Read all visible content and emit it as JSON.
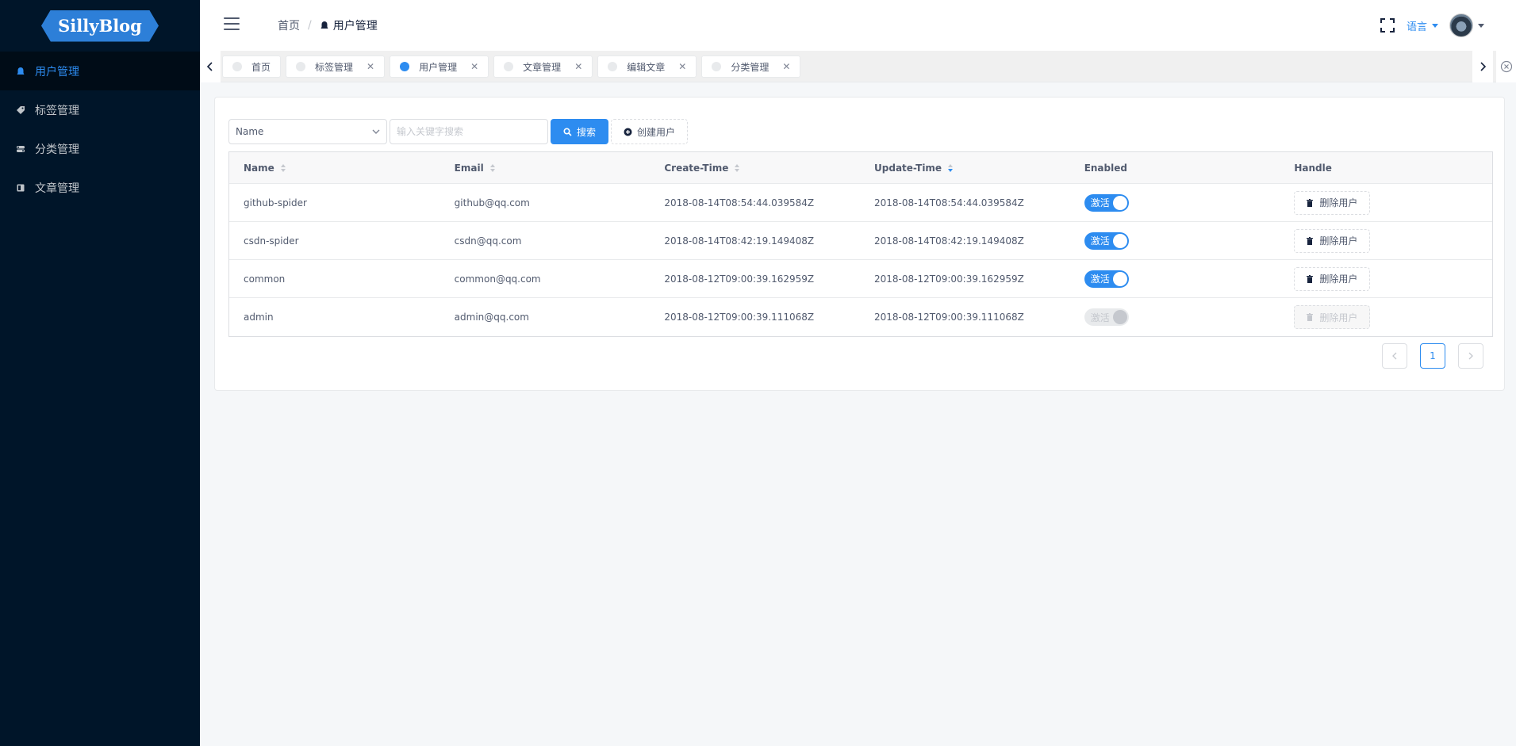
{
  "app": {
    "logo_text": "SillyBlog"
  },
  "sidebar": {
    "items": [
      {
        "label": "用户管理",
        "icon": "user-icon",
        "active": true
      },
      {
        "label": "标签管理",
        "icon": "tag-icon",
        "active": false
      },
      {
        "label": "分类管理",
        "icon": "category-icon",
        "active": false
      },
      {
        "label": "文章管理",
        "icon": "article-icon",
        "active": false
      }
    ]
  },
  "header": {
    "breadcrumb": {
      "home": "首页",
      "separator": "/",
      "current": "用户管理"
    },
    "language_label": "语言"
  },
  "tags": [
    {
      "label": "首页",
      "active": false,
      "closable": false
    },
    {
      "label": "标签管理",
      "active": false,
      "closable": true
    },
    {
      "label": "用户管理",
      "active": true,
      "closable": true
    },
    {
      "label": "文章管理",
      "active": false,
      "closable": true
    },
    {
      "label": "编辑文章",
      "active": false,
      "closable": true
    },
    {
      "label": "分类管理",
      "active": false,
      "closable": true
    }
  ],
  "filter": {
    "select_value": "Name",
    "search_placeholder": "输入关键字搜索",
    "search_button": "搜索",
    "create_button": "创建用户"
  },
  "table": {
    "columns": [
      "Name",
      "Email",
      "Create-Time",
      "Update-Time",
      "Enabled",
      "Handle"
    ],
    "rows": [
      {
        "name": "github-spider",
        "email": "github@qq.com",
        "create_time": "2018-08-14T08:54:44.039584Z",
        "update_time": "2018-08-14T08:54:44.039584Z",
        "enabled": "激活",
        "handle": "删除用户"
      },
      {
        "name": "csdn-spider",
        "email": "csdn@qq.com",
        "create_time": "2018-08-14T08:42:19.149408Z",
        "update_time": "2018-08-14T08:42:19.149408Z",
        "enabled": "激活",
        "handle": "删除用户"
      },
      {
        "name": "common",
        "email": "common@qq.com",
        "create_time": "2018-08-12T09:00:39.162959Z",
        "update_time": "2018-08-12T09:00:39.162959Z",
        "enabled": "激活",
        "handle": "删除用户"
      },
      {
        "name": "admin",
        "email": "admin@qq.com",
        "create_time": "2018-08-12T09:00:39.111068Z",
        "update_time": "2018-08-12T09:00:39.111068Z",
        "enabled": "激活",
        "handle": "删除用户"
      }
    ]
  },
  "pagination": {
    "current_page": "1"
  },
  "colors": {
    "primary": "#2d8cf0",
    "sidebar_bg": "#001529",
    "logo_bg": "#2d7fd8"
  }
}
